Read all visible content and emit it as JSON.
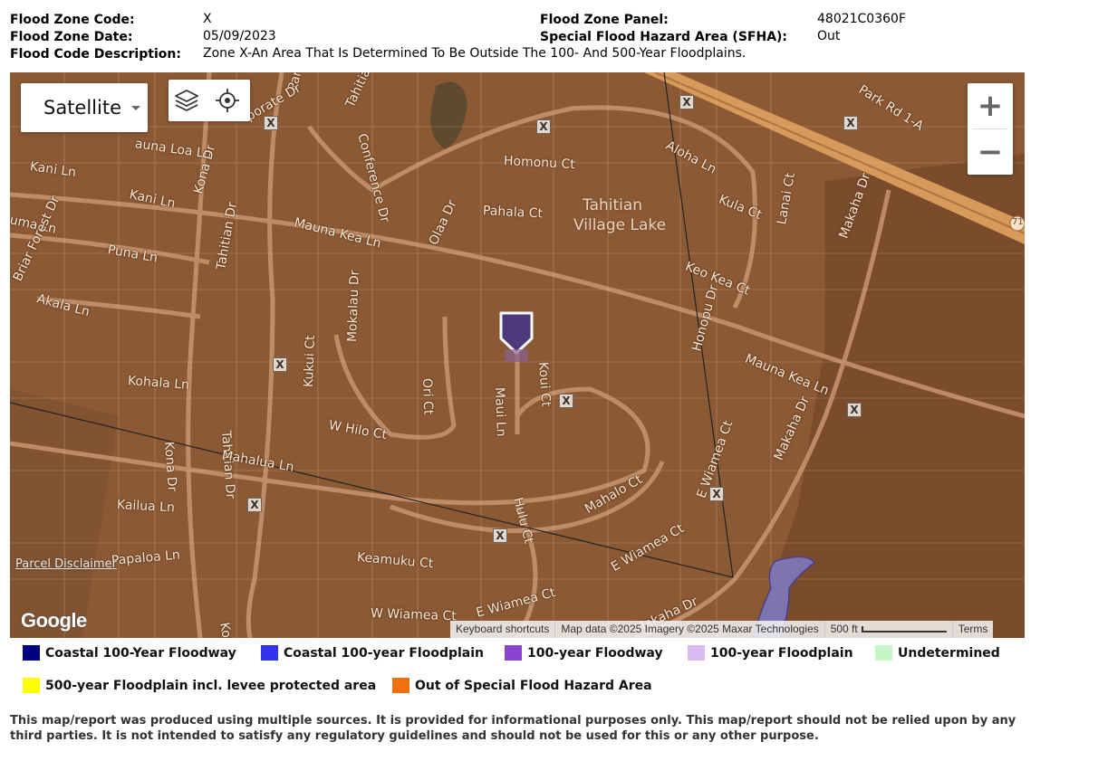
{
  "header": {
    "flood_zone_code_label": "Flood Zone Code:",
    "flood_zone_code": "X",
    "flood_zone_date_label": "Flood Zone Date:",
    "flood_zone_date": "05/09/2023",
    "flood_code_description_label": "Flood Code Description:",
    "flood_code_description": "Zone X-An Area That Is Determined To Be Outside The 100- And 500-Year Floodplains.",
    "flood_zone_panel_label": "Flood Zone Panel:",
    "flood_zone_panel": "48021C0360F",
    "sfha_label": "Special Flood Hazard Area (SFHA):",
    "sfha": "Out"
  },
  "map": {
    "map_type_label": "Satellite",
    "layers_icon": "layers-icon",
    "locate_icon": "crosshair-icon",
    "zoom_in": "+",
    "zoom_out": "−",
    "zone_marker": "X",
    "lake_label_1": "Tahitian",
    "lake_label_2": "Village Lake",
    "streets": [
      "Park",
      "Tahitian",
      "porate Dr",
      "Conference Dr",
      "auna Loa Ln",
      "Kani Ln",
      "Kani Ln",
      "uma Ln",
      "Briar Forest Dr",
      "Kona Dr",
      "Homonu Ct",
      "Aloha Ln",
      "Park Rd 1-A",
      "Pahala Ct",
      "Kula Ct",
      "Lanai Ct",
      "Makaha Dr",
      "Mauna Kea Ln",
      "Olaa Dr",
      "Puna Ln",
      "Keo Kea Ct",
      "Akala Ln",
      "Honopu Dr",
      "Mauna Kea Ln",
      "Tahitian Dr",
      "Mokalau Dr",
      "Ori Ct",
      "Maui Ln",
      "Koui Ct",
      "Kukui Ct",
      "Kohala Ln",
      "W Hilo Ct",
      "Tahitian Dr",
      "Kona Dr",
      "Makaha Dr",
      "E Wiamea Ct",
      "Mahalua Ln",
      "Kailua Ln",
      "Hulu Ct",
      "Mahalo Ct",
      "Keamuku Ct",
      "Papaloa Ln",
      "E Wiamea Ct",
      "W Wiamea Ct",
      "E Wiamea Ct",
      "Makaha Dr",
      "Kon",
      "71"
    ],
    "parcel_disclaimer": "Parcel Disclaimer",
    "google_logo": "Google",
    "attribution": {
      "keyboard_shortcuts": "Keyboard shortcuts",
      "map_data": "Map data ©2025 Imagery ©2025 Maxar Technologies",
      "scale": "500 ft",
      "terms": "Terms"
    }
  },
  "legend": [
    {
      "label": "Coastal 100-Year Floodway",
      "color": "#000080"
    },
    {
      "label": "Coastal 100-year Floodplain",
      "color": "#3333ee"
    },
    {
      "label": "100-year Floodway",
      "color": "#8844cc"
    },
    {
      "label": "100-year Floodplain",
      "color": "#d8bbf0"
    },
    {
      "label": "Undetermined",
      "color": "#c8f5c8"
    },
    {
      "label": "500-year Floodplain incl. levee protected area",
      "color": "#ffff00"
    },
    {
      "label": "Out of Special Flood Hazard Area",
      "color": "#f07010"
    }
  ],
  "disclaimer": "This map/report was produced using multiple sources. It is provided for informational purposes only. This map/report should not be relied upon by any third parties. It is not intended to satisfy any regulatory guidelines and should not be used for this or any other purpose."
}
